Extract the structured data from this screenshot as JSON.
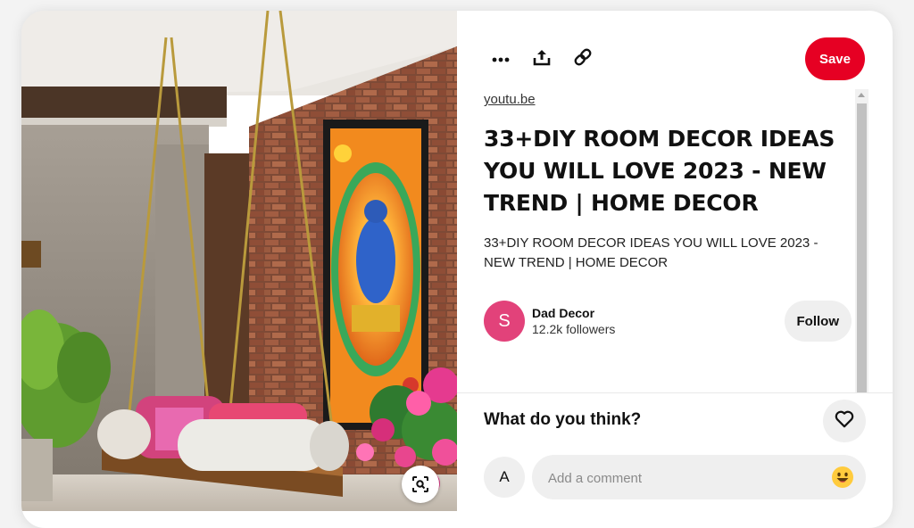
{
  "toolbar": {
    "more_icon": "ellipsis-icon",
    "share_icon": "share-upload-icon",
    "link_icon": "link-icon",
    "save_label": "Save"
  },
  "pin": {
    "source": "youtu.be",
    "title": "33+DIY ROOM DECOR IDEAS YOU WILL LOVE 2023 - NEW TREND | HOME DECOR",
    "description": "33+DIY ROOM DECOR IDEAS YOU WILL LOVE 2023 - NEW TREND | HOME DECOR"
  },
  "creator": {
    "avatar_letter": "S",
    "avatar_color": "#e2427a",
    "name": "Dad Decor",
    "followers": "12.2k followers",
    "follow_label": "Follow"
  },
  "comments": {
    "heading": "What do you think?",
    "react_icon": "heart-icon",
    "user_avatar_letter": "A",
    "placeholder": "Add a comment",
    "emoji_icon": "smiley-emoji-icon"
  },
  "image": {
    "visual_search_icon": "visual-search-icon"
  },
  "colors": {
    "accent": "#e60023",
    "button_gray": "#efefef"
  }
}
